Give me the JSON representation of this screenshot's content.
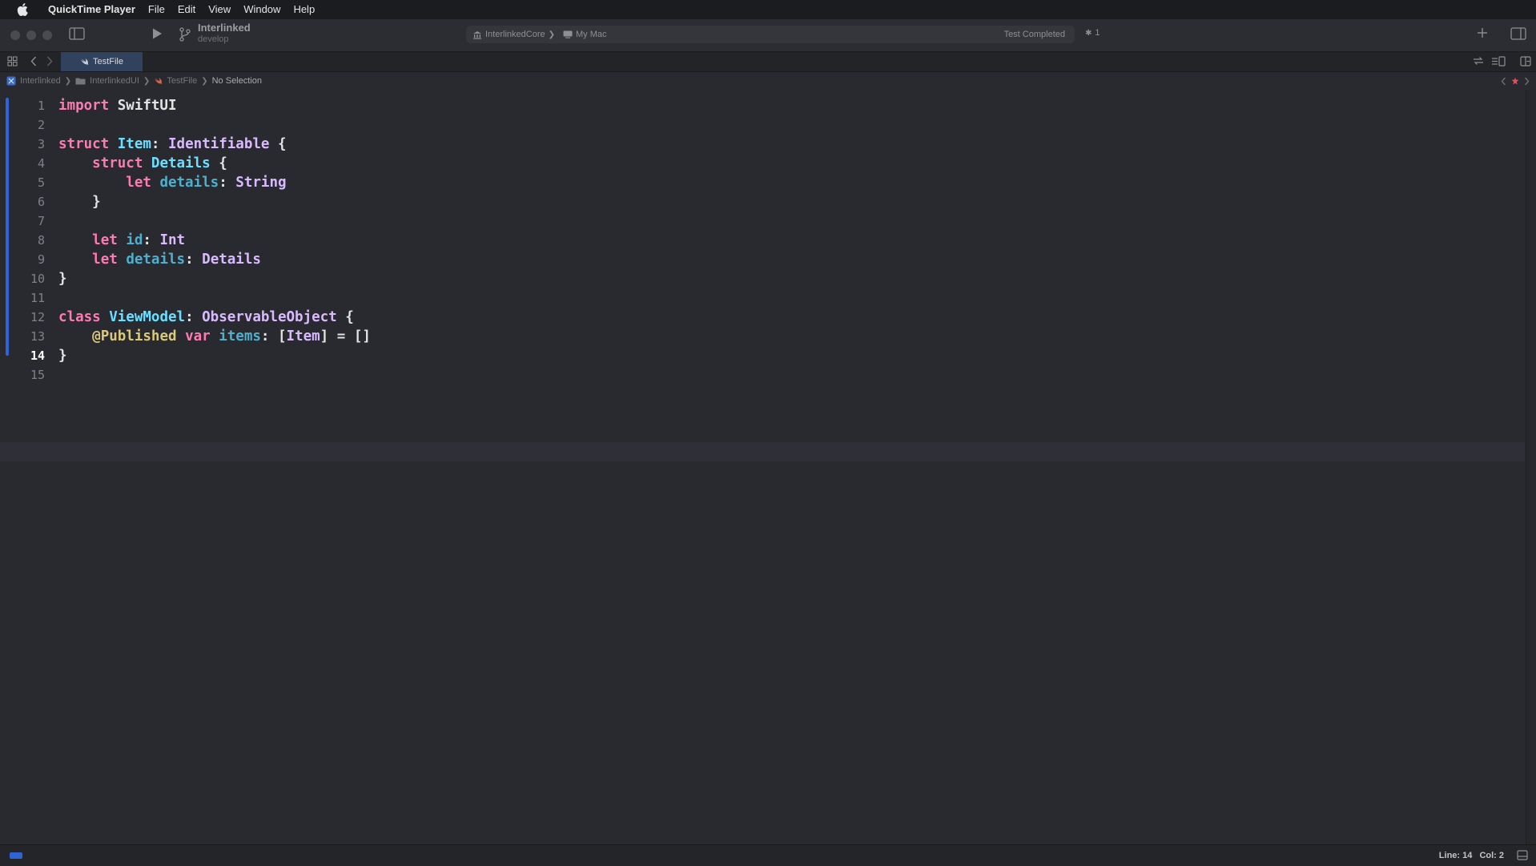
{
  "menubar": {
    "app_name": "QuickTime Player",
    "items": [
      "File",
      "Edit",
      "View",
      "Window",
      "Help"
    ]
  },
  "toolbar": {
    "scheme_name": "Interlinked",
    "branch": "develop",
    "activity": {
      "target": "InterlinkedCore",
      "destination": "My Mac",
      "status": "Test Completed",
      "issue_count": "1"
    }
  },
  "tab": {
    "label": "TestFile"
  },
  "jumpbar": {
    "project": "Interlinked",
    "group": "InterlinkedUI",
    "file": "TestFile",
    "selection": "No Selection"
  },
  "editor": {
    "line_numbers": [
      "1",
      "2",
      "3",
      "4",
      "5",
      "6",
      "7",
      "8",
      "9",
      "10",
      "11",
      "12",
      "13",
      "14",
      "15"
    ],
    "current_line": 14,
    "lines": [
      [
        {
          "t": "import",
          "c": "kw"
        },
        {
          "t": " SwiftUI",
          "c": "plain"
        }
      ],
      [],
      [
        {
          "t": "struct",
          "c": "kw"
        },
        {
          "t": " ",
          "c": "plain"
        },
        {
          "t": "Item",
          "c": "decl"
        },
        {
          "t": ": ",
          "c": "plain"
        },
        {
          "t": "Identifiable",
          "c": "type"
        },
        {
          "t": " {",
          "c": "plain"
        }
      ],
      [
        {
          "t": "    ",
          "c": "plain"
        },
        {
          "t": "struct",
          "c": "kw"
        },
        {
          "t": " ",
          "c": "plain"
        },
        {
          "t": "Details",
          "c": "decl"
        },
        {
          "t": " {",
          "c": "plain"
        }
      ],
      [
        {
          "t": "        ",
          "c": "plain"
        },
        {
          "t": "let",
          "c": "kw"
        },
        {
          "t": " ",
          "c": "plain"
        },
        {
          "t": "details",
          "c": "prop"
        },
        {
          "t": ": ",
          "c": "plain"
        },
        {
          "t": "String",
          "c": "type"
        }
      ],
      [
        {
          "t": "    }",
          "c": "plain"
        }
      ],
      [],
      [
        {
          "t": "    ",
          "c": "plain"
        },
        {
          "t": "let",
          "c": "kw"
        },
        {
          "t": " ",
          "c": "plain"
        },
        {
          "t": "id",
          "c": "prop"
        },
        {
          "t": ": ",
          "c": "plain"
        },
        {
          "t": "Int",
          "c": "type"
        }
      ],
      [
        {
          "t": "    ",
          "c": "plain"
        },
        {
          "t": "let",
          "c": "kw"
        },
        {
          "t": " ",
          "c": "plain"
        },
        {
          "t": "details",
          "c": "prop"
        },
        {
          "t": ": ",
          "c": "plain"
        },
        {
          "t": "Details",
          "c": "type"
        }
      ],
      [
        {
          "t": "}",
          "c": "plain"
        }
      ],
      [],
      [
        {
          "t": "class",
          "c": "kw"
        },
        {
          "t": " ",
          "c": "plain"
        },
        {
          "t": "ViewModel",
          "c": "decl"
        },
        {
          "t": ": ",
          "c": "plain"
        },
        {
          "t": "ObservableObject",
          "c": "type"
        },
        {
          "t": " {",
          "c": "plain"
        }
      ],
      [
        {
          "t": "    ",
          "c": "plain"
        },
        {
          "t": "@Published",
          "c": "attr"
        },
        {
          "t": " ",
          "c": "plain"
        },
        {
          "t": "var",
          "c": "kw"
        },
        {
          "t": " ",
          "c": "plain"
        },
        {
          "t": "items",
          "c": "prop"
        },
        {
          "t": ": [",
          "c": "plain"
        },
        {
          "t": "Item",
          "c": "type"
        },
        {
          "t": "] = []",
          "c": "plain"
        }
      ],
      [
        {
          "t": "}",
          "c": "plain"
        }
      ],
      []
    ]
  },
  "statusbar": {
    "line_label": "Line: 14",
    "col_label": "Col: 2"
  },
  "icons": {
    "apple": "apple-logo-icon",
    "sidebar": "sidebar-toggle-icon",
    "run": "play-icon",
    "branch": "source-branch-icon",
    "add": "plus-icon",
    "inspector": "inspector-toggle-icon"
  },
  "colors": {
    "keyword": "#ff7ab2",
    "type": "#dabaff",
    "declaration": "#6bdfff",
    "property": "#4eb0cc",
    "attribute": "#d9c97c",
    "accent": "#2f64d6"
  }
}
